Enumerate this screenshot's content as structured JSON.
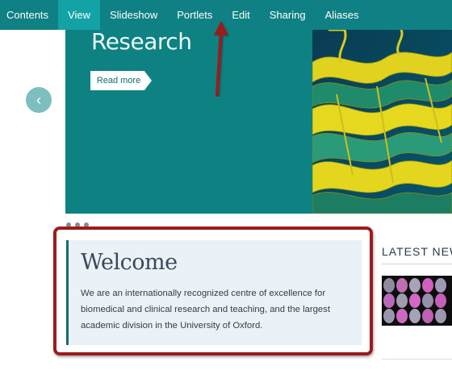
{
  "toolbar": {
    "items": [
      {
        "label": "Contents",
        "active": false
      },
      {
        "label": "View",
        "active": true
      },
      {
        "label": "Slideshow",
        "active": false
      },
      {
        "label": "Portlets",
        "active": false
      },
      {
        "label": "Edit",
        "active": false
      },
      {
        "label": "Sharing",
        "active": false
      },
      {
        "label": "Aliases",
        "active": false
      }
    ]
  },
  "hero": {
    "title": "Research",
    "read_more": "Read more",
    "prev_icon": "chevron-left-icon"
  },
  "welcome": {
    "title": "Welcome",
    "text": "We are an internationally recognized centre of excellence for biomedical and clinical research and teaching, and the largest academic division in the University of Oxford."
  },
  "news": {
    "title": "LATEST NEWS"
  },
  "colors": {
    "toolbar": "#0f8083",
    "toolbar_active": "#13a3a6",
    "hero": "#0e8183",
    "annotation": "#9b1b1e"
  }
}
